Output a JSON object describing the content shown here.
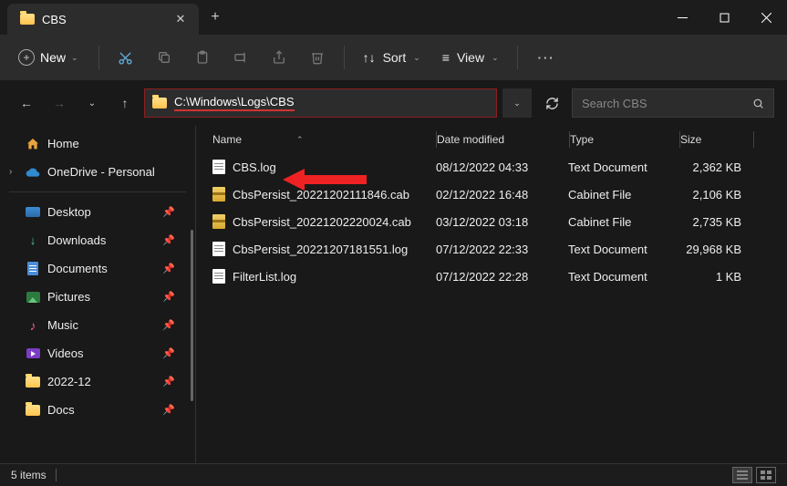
{
  "tab": {
    "title": "CBS"
  },
  "toolbar": {
    "new_label": "New",
    "sort_label": "Sort",
    "view_label": "View"
  },
  "address": {
    "path": "C:\\Windows\\Logs\\CBS"
  },
  "search": {
    "placeholder": "Search CBS"
  },
  "sidebar": {
    "home": "Home",
    "onedrive": "OneDrive - Personal",
    "desktop": "Desktop",
    "downloads": "Downloads",
    "documents": "Documents",
    "pictures": "Pictures",
    "music": "Music",
    "videos": "Videos",
    "f1": "2022-12",
    "f2": "Docs"
  },
  "columns": {
    "name": "Name",
    "date": "Date modified",
    "type": "Type",
    "size": "Size"
  },
  "files": [
    {
      "name": "CBS.log",
      "date": "08/12/2022 04:33",
      "type": "Text Document",
      "size": "2,362 KB",
      "icon": "txt"
    },
    {
      "name": "CbsPersist_20221202111846.cab",
      "date": "02/12/2022 16:48",
      "type": "Cabinet File",
      "size": "2,106 KB",
      "icon": "cab"
    },
    {
      "name": "CbsPersist_20221202220024.cab",
      "date": "03/12/2022 03:18",
      "type": "Cabinet File",
      "size": "2,735 KB",
      "icon": "cab"
    },
    {
      "name": "CbsPersist_20221207181551.log",
      "date": "07/12/2022 22:33",
      "type": "Text Document",
      "size": "29,968 KB",
      "icon": "txt"
    },
    {
      "name": "FilterList.log",
      "date": "07/12/2022 22:28",
      "type": "Text Document",
      "size": "1 KB",
      "icon": "txt"
    }
  ],
  "status": {
    "count": "5 items"
  }
}
